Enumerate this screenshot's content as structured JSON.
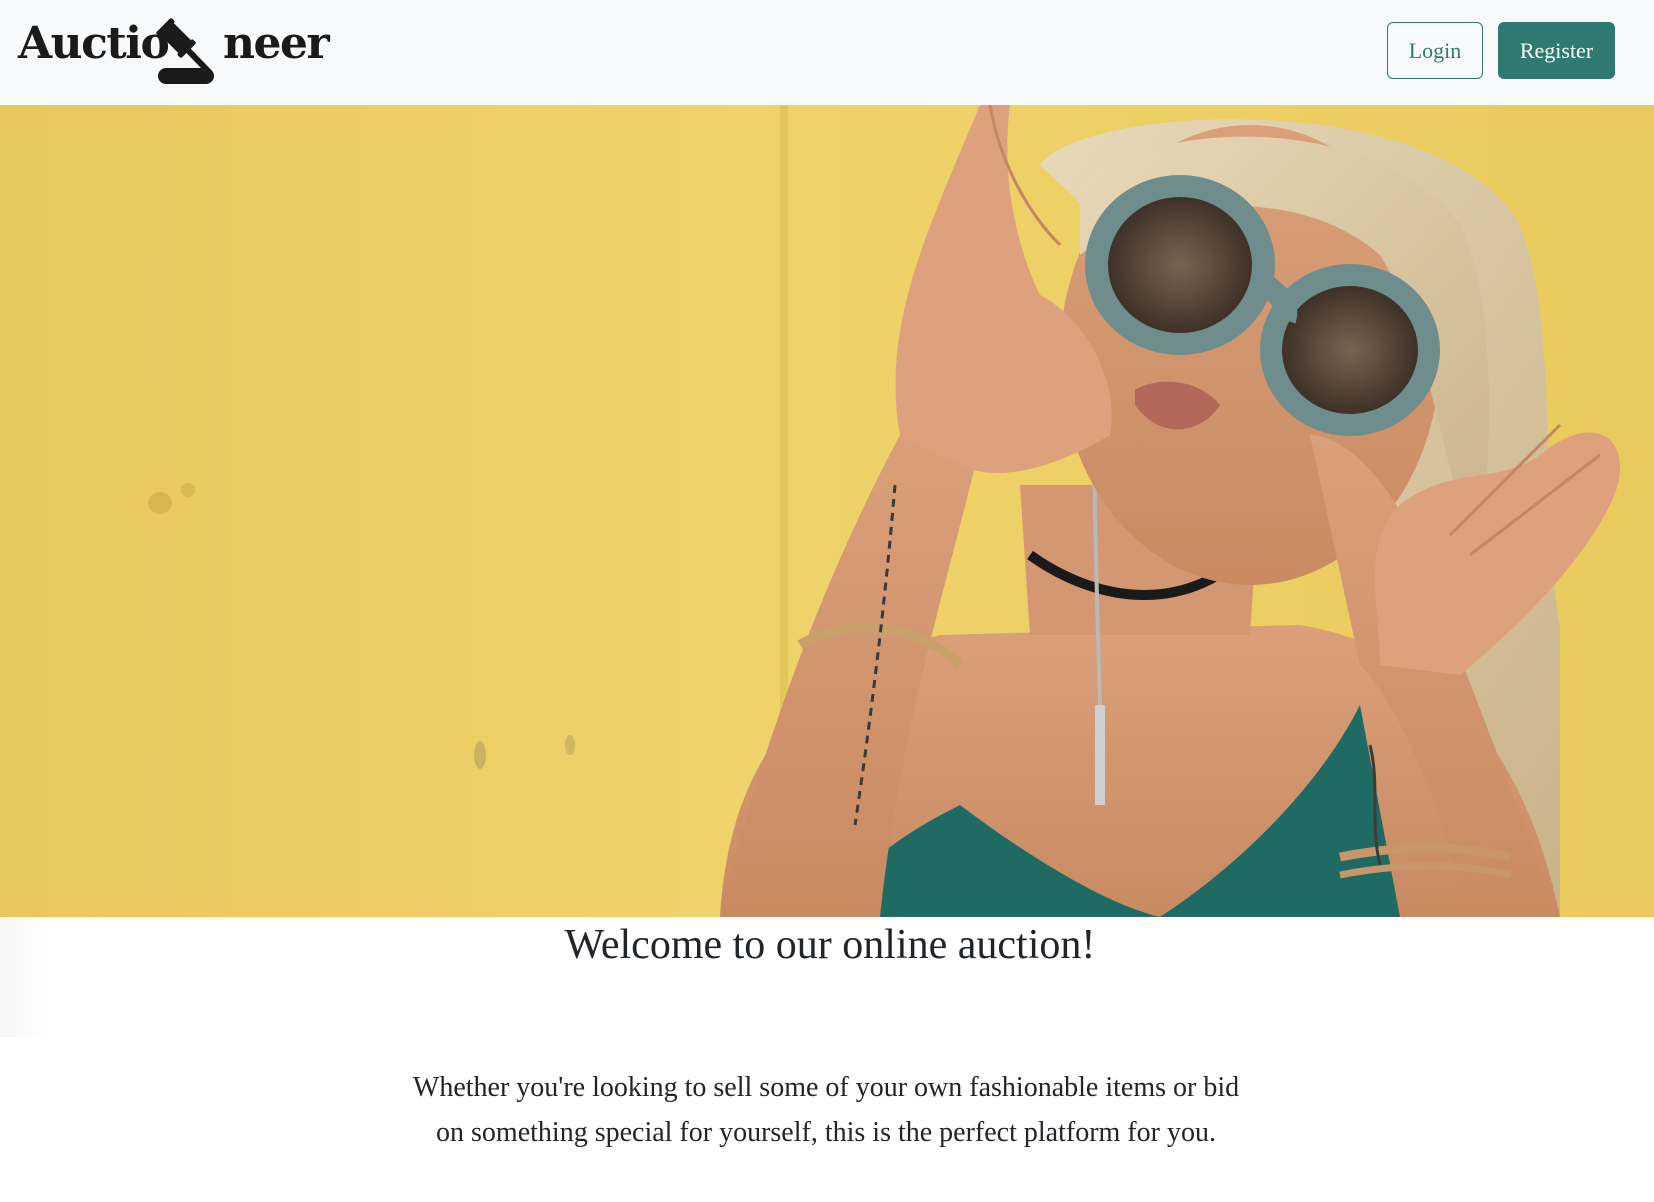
{
  "brand": {
    "logo_left": "Auctio",
    "logo_right": "neer",
    "logo_icon": "gavel-icon"
  },
  "nav": {
    "login_label": "Login",
    "register_label": "Register"
  },
  "hero": {
    "image_description_icon": "hero-photo"
  },
  "welcome": {
    "title": "Welcome to our online auction!",
    "text": "Whether you're looking to sell some of your own fashionable items or bid on something special for yourself, this is the perfect platform for you."
  },
  "colors": {
    "accent": "#2f7a70",
    "navbar_bg": "#f8f9fa",
    "hero_bg": "#eed063",
    "text": "#212529"
  }
}
